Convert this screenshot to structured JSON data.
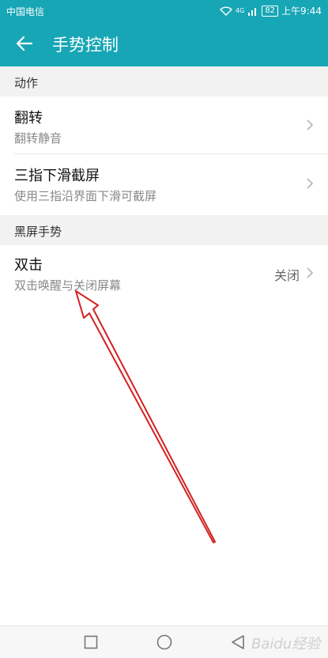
{
  "status_bar": {
    "carrier": "中国电信",
    "network": "4G",
    "battery": "82",
    "time": "上午9:44"
  },
  "app_bar": {
    "title": "手势控制",
    "back_icon": "arrow-left-icon"
  },
  "sections": [
    {
      "header": "动作",
      "items": [
        {
          "title": "翻转",
          "subtitle": "翻转静音"
        },
        {
          "title": "三指下滑截屏",
          "subtitle": "使用三指沿界面下滑可截屏"
        }
      ]
    },
    {
      "header": "黑屏手势",
      "items": [
        {
          "title": "双击",
          "subtitle": "双击唤醒与关闭屏幕",
          "value": "关闭"
        }
      ]
    }
  ],
  "nav_bar": {
    "icons": [
      "square-icon",
      "circle-icon",
      "triangle-back-icon"
    ]
  },
  "watermark": "Baidu经验",
  "colors": {
    "accent": "#17a6b5",
    "annotation": "#d42020"
  }
}
